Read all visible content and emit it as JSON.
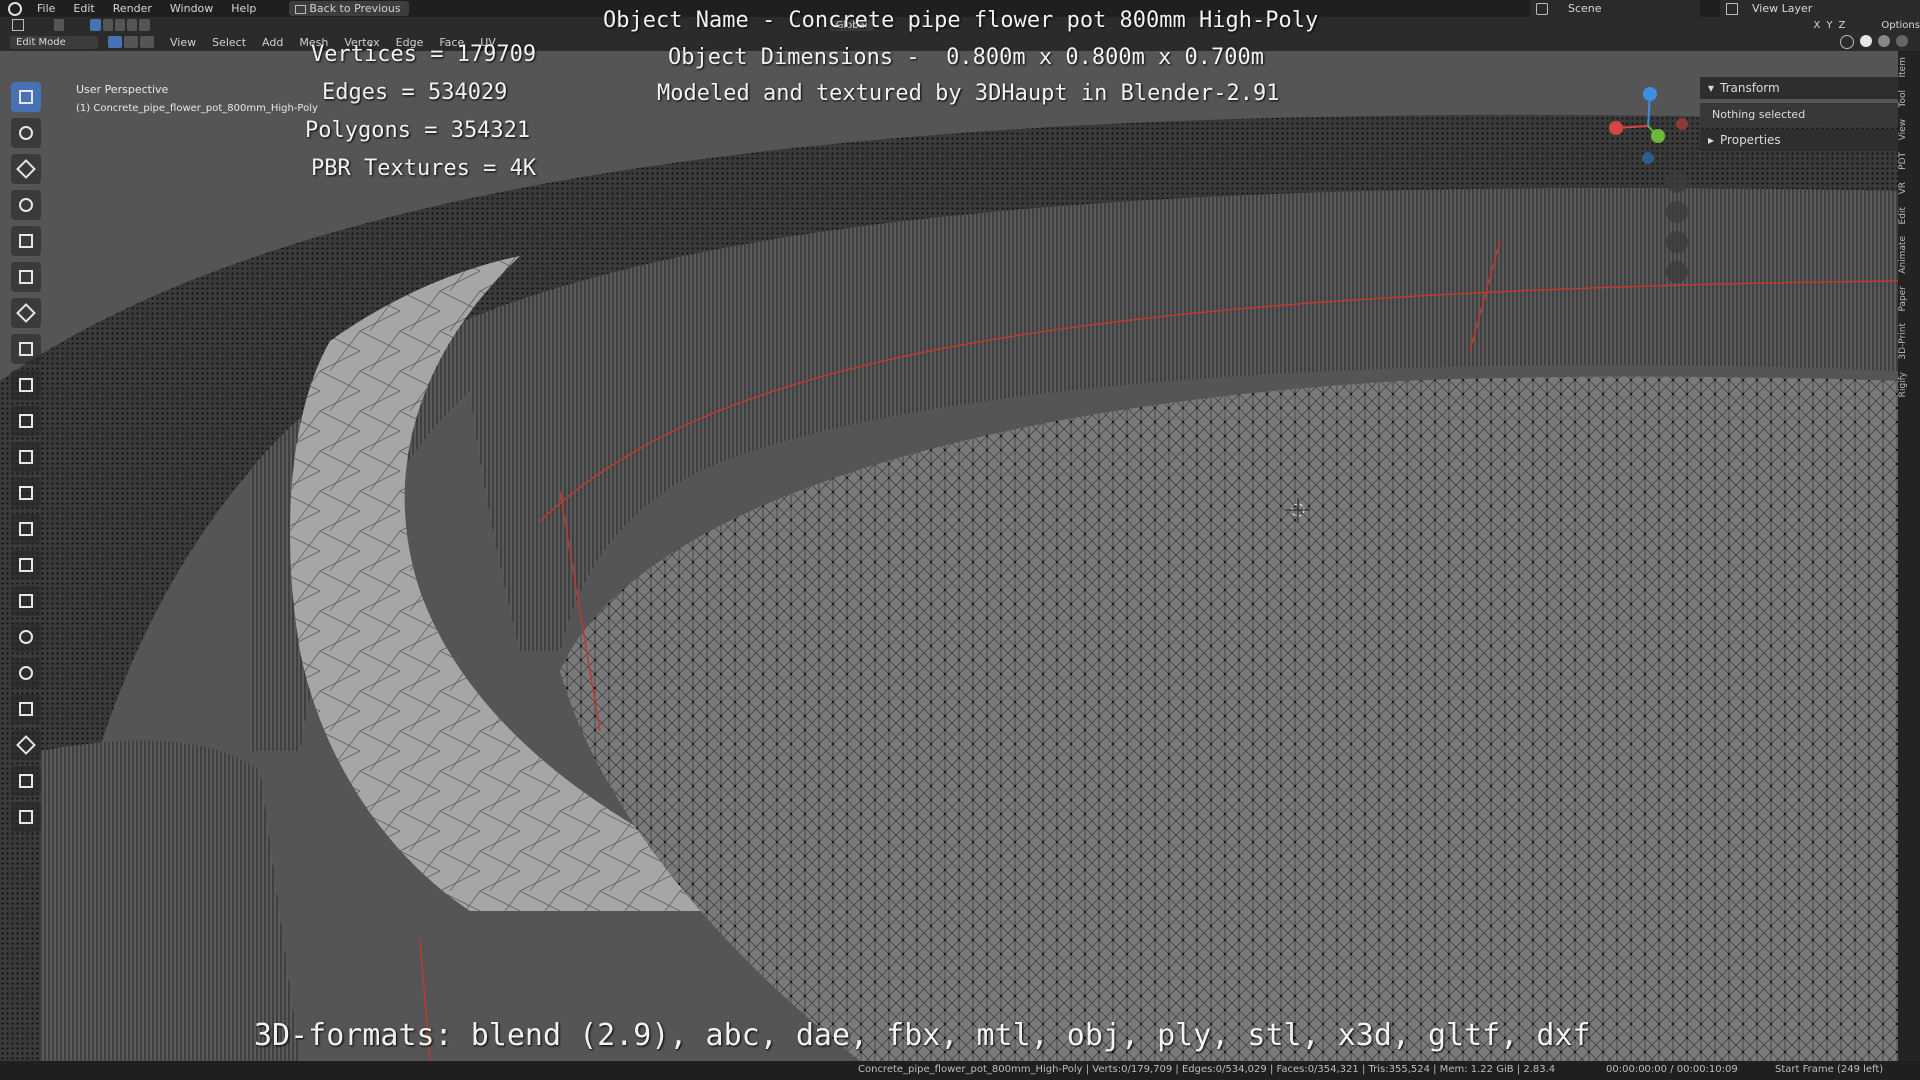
{
  "menu": {
    "items": [
      "File",
      "Edit",
      "Render",
      "Window",
      "Help"
    ],
    "back_button": "Back to Previous"
  },
  "scene": {
    "label": "Scene",
    "view_layer": "View Layer"
  },
  "toolbar": {
    "orientation": "Global",
    "axes": [
      "X",
      "Y",
      "Z"
    ],
    "options": "Options"
  },
  "header": {
    "mode": "Edit Mode",
    "menus": [
      "View",
      "Select",
      "Add",
      "Mesh",
      "Vertex",
      "Edge",
      "Face",
      "UV"
    ]
  },
  "viewport": {
    "perspective": "User Perspective",
    "object": "(1) Concrete_pipe_flower_pot_800mm_High-Poly"
  },
  "overlay": {
    "stats": [
      "Vertices = 179709",
      "Edges = 534029",
      "Polygons = 354321",
      "PBR Textures = 4K"
    ],
    "title_lines": [
      "Object Name - Concrete pipe flower pot 800mm High-Poly",
      "Object Dimensions -  0.800m x 0.800m x 0.700m",
      "Modeled and textured by 3DHaupt in Blender-2.91"
    ],
    "formats": "3D-formats: blend (2.9), abc, dae, fbx, mtl, obj, ply, stl, x3d, gltf, dxf"
  },
  "properties_panel": {
    "transform": "Transform",
    "nothing_selected": "Nothing selected",
    "properties": "Properties"
  },
  "side_tabs": [
    "Item",
    "Tool",
    "View",
    "PDT",
    "VR",
    "Edit",
    "Animate",
    "Paper",
    "3D-Print",
    "Rigify"
  ],
  "status": {
    "stats": "Concrete_pipe_flower_pot_800mm_High-Poly | Verts:0/179,709 | Edges:0/534,029 | Faces:0/354,321 | Tris:355,524 | Mem: 1.22 GiB | 2.83.4",
    "time": "00:00:00:00 / 00:00:10:09",
    "frame": "Start Frame (249 left)"
  },
  "colors": {
    "accent": "#4772b3",
    "seam": "#c0392b",
    "gizmo_x": "#d64545",
    "gizmo_y": "#6bb83a",
    "gizmo_z": "#3f8de0"
  }
}
